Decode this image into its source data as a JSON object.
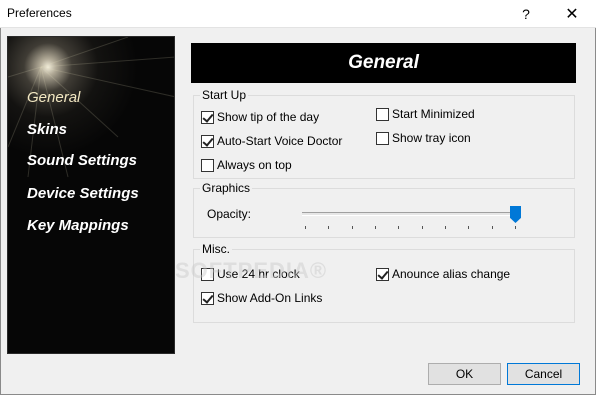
{
  "window": {
    "title": "Preferences",
    "help_glyph": "?",
    "close_glyph": "✕"
  },
  "sidebar": {
    "items": [
      {
        "label": "General",
        "active": true
      },
      {
        "label": "Skins",
        "active": false
      },
      {
        "label": "Sound Settings",
        "active": false
      },
      {
        "label": "Device Settings",
        "active": false
      },
      {
        "label": "Key Mappings",
        "active": false
      }
    ]
  },
  "main": {
    "header": "General",
    "startup": {
      "title": "Start Up",
      "options": {
        "show_tip": {
          "label": "Show tip of the day",
          "checked": true
        },
        "start_minimized": {
          "label": "Start Minimized",
          "checked": false
        },
        "auto_start": {
          "label": "Auto-Start Voice Doctor",
          "checked": true
        },
        "show_tray": {
          "label": "Show tray icon",
          "checked": false
        },
        "always_on_top": {
          "label": "Always on top",
          "checked": false
        }
      }
    },
    "graphics": {
      "title": "Graphics",
      "opacity_label": "Opacity:",
      "opacity_value": 1.0,
      "tick_count": 10
    },
    "misc": {
      "title": "Misc.",
      "options": {
        "use_24hr": {
          "label": "Use 24 hr clock",
          "checked": false
        },
        "alias_change": {
          "label": "Anounce alias change",
          "checked": true
        },
        "addon_links": {
          "label": "Show Add-On Links",
          "checked": true
        }
      }
    }
  },
  "buttons": {
    "ok": "OK",
    "cancel": "Cancel"
  },
  "watermark": "SOFTPEDIA®",
  "colors": {
    "accent": "#0078d7",
    "nav_bg": "#060606",
    "header_bg": "#000000"
  }
}
